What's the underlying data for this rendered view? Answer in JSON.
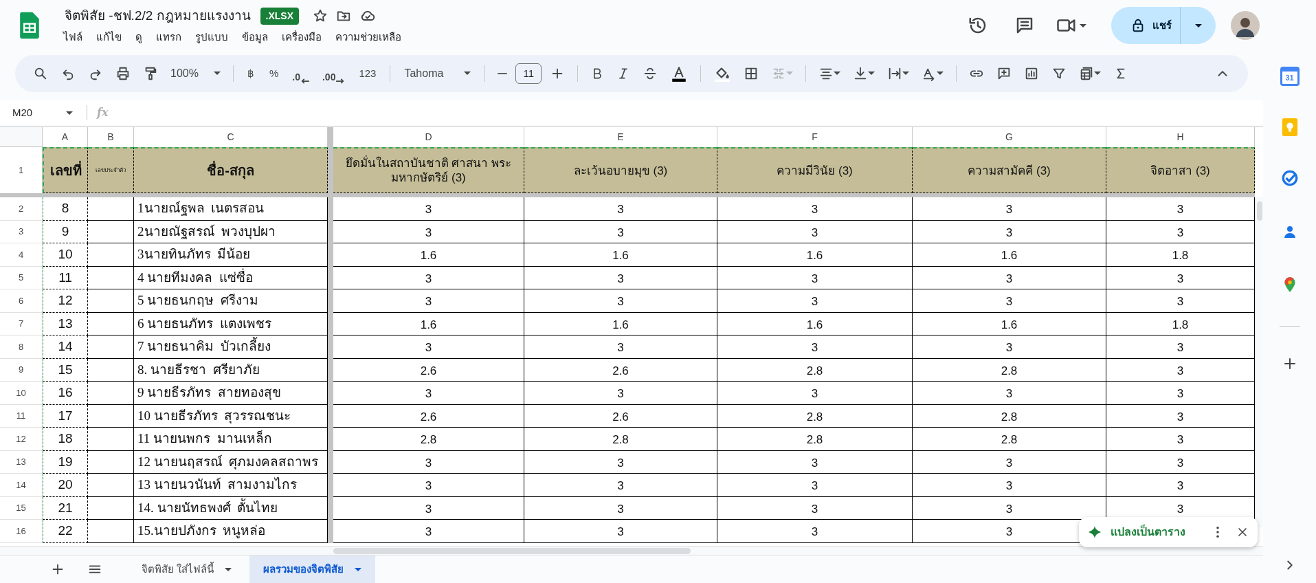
{
  "document": {
    "title": "จิตพิสัย -ชฟ.2/2 กฎหมายแรงงาน",
    "badge": ".XLSX",
    "share_label": "แชร์"
  },
  "menu": [
    "ไฟล์",
    "แก้ไข",
    "ดู",
    "แทรก",
    "รูปแบบ",
    "ข้อมูล",
    "เครื่องมือ",
    "ความช่วยเหลือ"
  ],
  "toolbar": {
    "zoom": "100%",
    "currency": "฿",
    "percent": "%",
    "decrease_decimal": ".0",
    "increase_decimal": ".00",
    "number_format": "123",
    "font": "Tahoma",
    "font_size": "11"
  },
  "formula_bar": {
    "cell": "M20",
    "fx": "fx"
  },
  "columns": [
    "A",
    "B",
    "C",
    "D",
    "E",
    "F",
    "G",
    "H"
  ],
  "header_row": {
    "number": "1",
    "cells": [
      "เลขที่",
      "เลขประจำตัว",
      "ชื่อ-สกุล",
      "ยึดมั่นในสถาบันชาติ ศาสนา พระมหากษัตริย์ (3)",
      "ละเว้นอบายมุข (3)",
      "ความมีวินัย (3)",
      "ความสามัคคี (3)",
      "จิตอาสา (3)"
    ]
  },
  "rows": [
    {
      "number": "2",
      "no": "8",
      "name": "1นายณ์ฐพล  เนตรสอน",
      "scores": [
        "3",
        "3",
        "3",
        "3",
        "3"
      ]
    },
    {
      "number": "3",
      "no": "9",
      "name": "2นายณัฐสรณ์  พวงบุปผา",
      "scores": [
        "3",
        "3",
        "3",
        "3",
        "3"
      ]
    },
    {
      "number": "4",
      "no": "10",
      "name": "3นายทินภัทร  มีน้อย",
      "scores": [
        "1.6",
        "1.6",
        "1.6",
        "1.6",
        "1.8"
      ]
    },
    {
      "number": "5",
      "no": "11",
      "name": "4 นายทีมงคล  แซ่ซื่อ",
      "scores": [
        "3",
        "3",
        "3",
        "3",
        "3"
      ]
    },
    {
      "number": "6",
      "no": "12",
      "name": "5 นายธนกฤษ  ศรีงาม",
      "scores": [
        "3",
        "3",
        "3",
        "3",
        "3"
      ]
    },
    {
      "number": "7",
      "no": "13",
      "name": "6 นายธนภัทร  แตงเพชร",
      "scores": [
        "1.6",
        "1.6",
        "1.6",
        "1.6",
        "1.8"
      ]
    },
    {
      "number": "8",
      "no": "14",
      "name": "7 นายธนาคิม  บัวเกลี้ยง",
      "scores": [
        "3",
        "3",
        "3",
        "3",
        "3"
      ]
    },
    {
      "number": "9",
      "no": "15",
      "name": "8. นายธีรชา  ศรียาภัย",
      "scores": [
        "2.6",
        "2.6",
        "2.8",
        "2.8",
        "3"
      ]
    },
    {
      "number": "10",
      "no": "16",
      "name": "9 นายธีรภัทร  สายทองสุข",
      "scores": [
        "3",
        "3",
        "3",
        "3",
        "3"
      ]
    },
    {
      "number": "11",
      "no": "17",
      "name": "10 นายธีรภัทร  สุวรรณชนะ",
      "scores": [
        "2.6",
        "2.6",
        "2.8",
        "2.8",
        "3"
      ]
    },
    {
      "number": "12",
      "no": "18",
      "name": "11 นายนพกร  มานเหล็ก",
      "scores": [
        "2.8",
        "2.8",
        "2.8",
        "2.8",
        "3"
      ]
    },
    {
      "number": "13",
      "no": "19",
      "name": "12 นายนฤสรณ์  ศุภมงคลสถาพร",
      "scores": [
        "3",
        "3",
        "3",
        "3",
        "3"
      ]
    },
    {
      "number": "14",
      "no": "20",
      "name": "13 นายนวนันท์  สามงามไกร",
      "scores": [
        "3",
        "3",
        "3",
        "3",
        "3"
      ]
    },
    {
      "number": "15",
      "no": "21",
      "name": "14. นายนัทธพงศ์  ตั้นไทย",
      "scores": [
        "3",
        "3",
        "3",
        "3",
        "3"
      ]
    },
    {
      "number": "16",
      "no": "22",
      "name": "15.นายปภังกร  หนูหล่อ",
      "scores": [
        "3",
        "3",
        "3",
        "3"
      ]
    }
  ],
  "sheet_tabs": [
    {
      "label": "จิตพิสัย ใส่ไฟล์นี้",
      "selected": false
    },
    {
      "label": "ผลรวมของจิตพิสัย",
      "selected": true
    }
  ],
  "toast": {
    "label": "แปลงเป็นตาราง"
  },
  "side_panel": {
    "calendar_label": "31"
  }
}
